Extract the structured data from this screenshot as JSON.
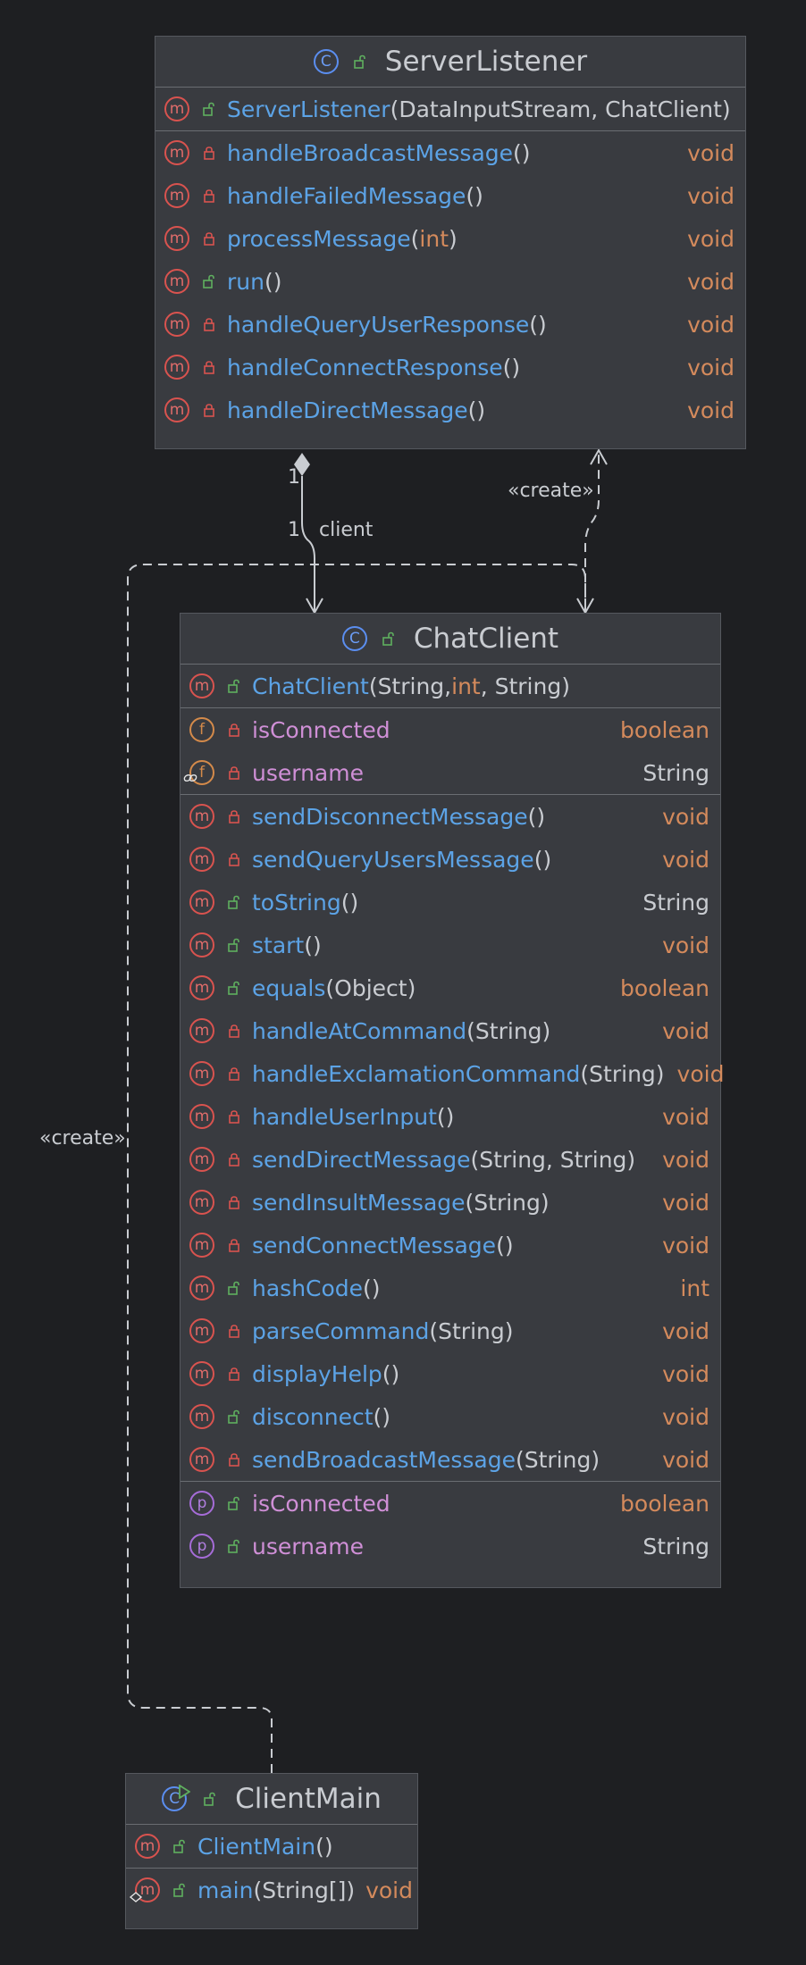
{
  "classes": {
    "server_listener": {
      "title": "ServerListener",
      "constructor": {
        "name": "ServerListener",
        "params": " (DataInputStream, ChatClient)"
      },
      "methods": [
        {
          "name": "handleBroadcastMessage",
          "params": " ()",
          "type": "void",
          "vis": "private"
        },
        {
          "name": "handleFailedMessage",
          "params": " ()",
          "type": "void",
          "vis": "private"
        },
        {
          "name": "processMessage",
          "params_before": " (",
          "params_kw": "int",
          "params_after": ")",
          "type": "void",
          "vis": "private"
        },
        {
          "name": "run",
          "params": " ()",
          "type": "void",
          "vis": "public"
        },
        {
          "name": "handleQueryUserResponse",
          "params": "  ()",
          "type": "void",
          "vis": "private"
        },
        {
          "name": "handleConnectResponse",
          "params": " ()",
          "type": "void",
          "vis": "private"
        },
        {
          "name": "handleDirectMessage",
          "params": " ()",
          "type": "void",
          "vis": "private"
        }
      ]
    },
    "chat_client": {
      "title": "ChatClient",
      "constructor": {
        "name": "ChatClient",
        "p1": " (String, ",
        "kw": "int",
        "p2": ", String)"
      },
      "fields": [
        {
          "name": "isConnected",
          "type": "boolean"
        },
        {
          "name": "username",
          "type": "String"
        }
      ],
      "methods": [
        {
          "name": "sendDisconnectMessage",
          "params": " ()",
          "type": "void",
          "vis": "private"
        },
        {
          "name": "sendQueryUsersMessage",
          "params": "  ()",
          "type": "void",
          "vis": "private"
        },
        {
          "name": "toString",
          "params": " ()",
          "type": "String",
          "vis": "public"
        },
        {
          "name": "start",
          "params": " ()",
          "type": "void",
          "vis": "public"
        },
        {
          "name": "equals",
          "params": " (Object)",
          "type": "boolean",
          "vis": "public"
        },
        {
          "name": "handleAtCommand",
          "params": " (String)",
          "type": "void",
          "vis": "private"
        },
        {
          "name": "handleExclamationCommand",
          "params": " (String)",
          "type": "void",
          "vis": "private"
        },
        {
          "name": "handleUserInput",
          "params": " ()",
          "type": "void",
          "vis": "private"
        },
        {
          "name": "sendDirectMessage",
          "params": " (String, String)",
          "type": "void",
          "vis": "private"
        },
        {
          "name": "sendInsultMessage",
          "params": " (String)",
          "type": "void",
          "vis": "private"
        },
        {
          "name": "sendConnectMessage",
          "params": " ()",
          "type": "void",
          "vis": "private"
        },
        {
          "name": "hashCode",
          "params": " ()",
          "type": "int",
          "vis": "public"
        },
        {
          "name": "parseCommand",
          "params": " (String)",
          "type": "void",
          "vis": "private"
        },
        {
          "name": "displayHelp",
          "params": " ()",
          "type": "void",
          "vis": "private"
        },
        {
          "name": "disconnect",
          "params": " ()",
          "type": "void",
          "vis": "public"
        },
        {
          "name": "sendBroadcastMessage",
          "params": " (String)",
          "type": "void",
          "vis": "private"
        }
      ],
      "properties": [
        {
          "name": "isConnected",
          "type": "boolean"
        },
        {
          "name": "username",
          "type": "String"
        }
      ]
    },
    "client_main": {
      "title": "ClientMain",
      "constructor": {
        "name": "ClientMain",
        "params": " ()"
      },
      "methods": [
        {
          "name": "main",
          "params": " (String[])",
          "type": "void"
        }
      ]
    }
  },
  "relations": {
    "create_label_1": "«create»",
    "create_label_2": "«create»",
    "mult_source": "1",
    "mult_target": "1",
    "role": "client"
  },
  "icons": {
    "method": "m",
    "field": "f",
    "property": "p",
    "class": "C"
  },
  "colors": {
    "background": "#1e1f22",
    "box": "#393b40",
    "method_name": "#5ca3e6",
    "field_name": "#cf8fd6",
    "type_keyword": "#d48a5c",
    "method_badge": "#d9534f",
    "public_green": "#5fb05f",
    "private_red": "#d9534f"
  }
}
